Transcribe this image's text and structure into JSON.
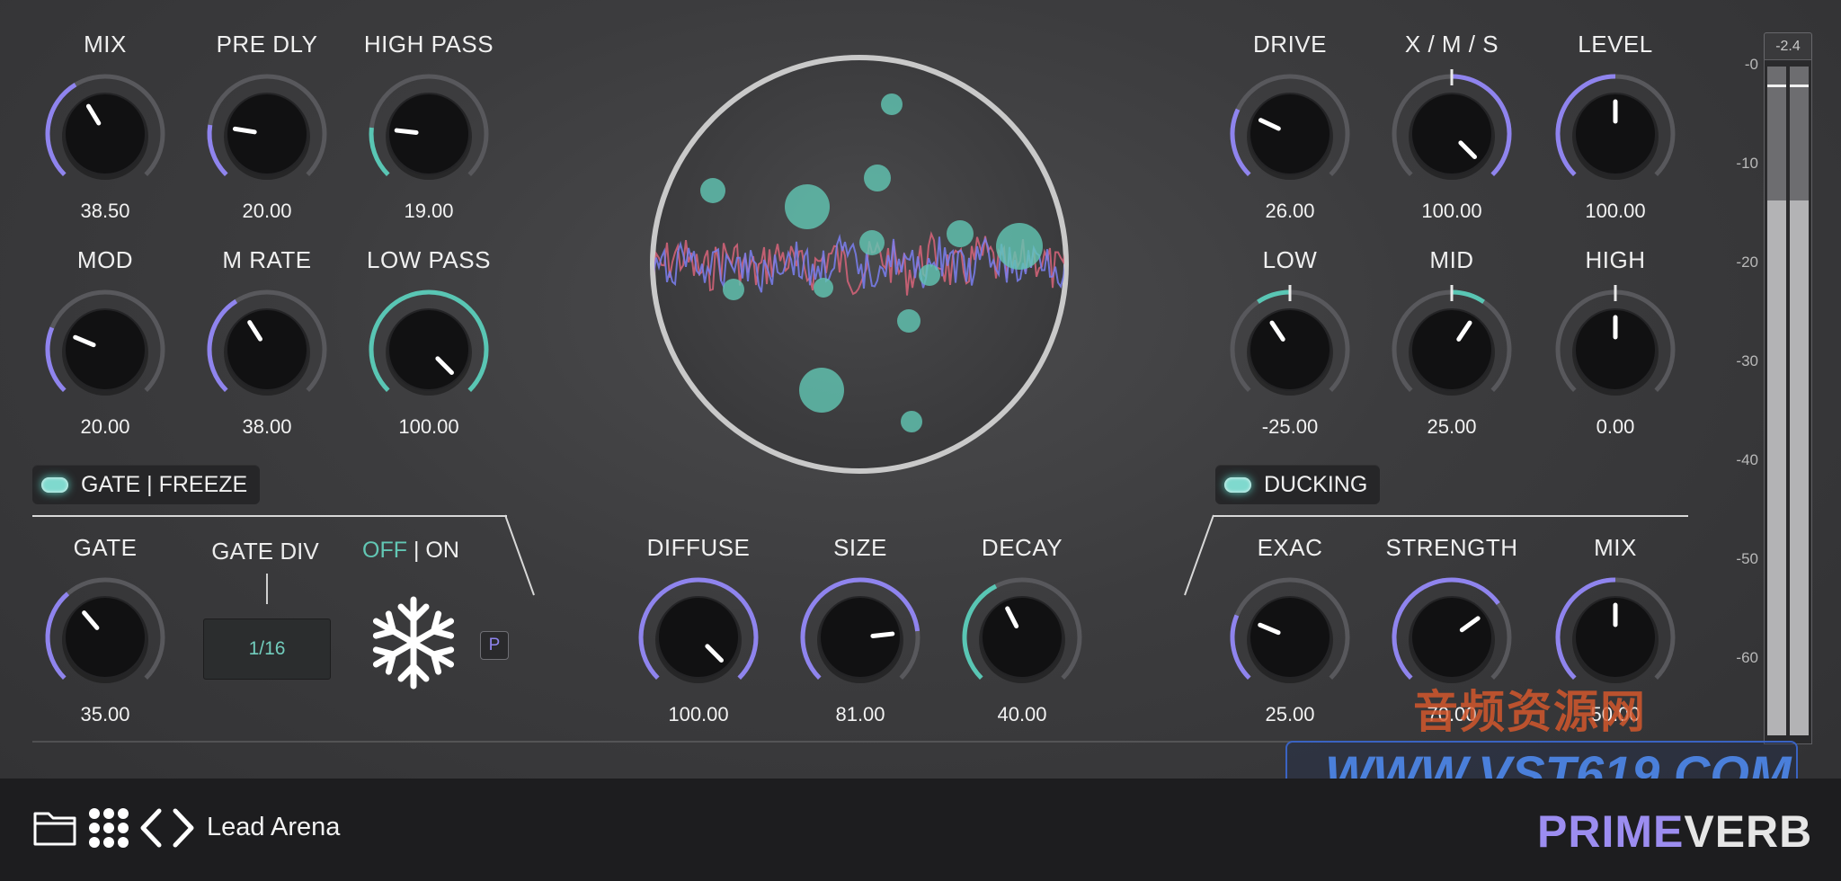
{
  "colors": {
    "accent_purple": "#8f84ee",
    "accent_teal": "#59c6b4",
    "track": "#58585c",
    "panel_bg": "#3b3b3d",
    "footer_bg": "#1d1d1f"
  },
  "knobs": [
    {
      "id": "mix",
      "label": "MIX",
      "value": "38.50",
      "fraction": 0.385,
      "arc": "purple"
    },
    {
      "id": "pre-dly",
      "label": "PRE DLY",
      "value": "20.00",
      "fraction": 0.2,
      "arc": "purple"
    },
    {
      "id": "high-pass",
      "label": "HIGH PASS",
      "value": "19.00",
      "fraction": 0.19,
      "arc": "teal"
    },
    {
      "id": "mod",
      "label": "MOD",
      "value": "20.00",
      "fraction": 0.25,
      "arc": "purple"
    },
    {
      "id": "m-rate",
      "label": "M RATE",
      "value": "38.00",
      "fraction": 0.38,
      "arc": "purple"
    },
    {
      "id": "low-pass",
      "label": "LOW PASS",
      "value": "100.00",
      "fraction": 1.0,
      "arc": "teal"
    },
    {
      "id": "drive",
      "label": "DRIVE",
      "value": "26.00",
      "fraction": 0.26,
      "arc": "purple"
    },
    {
      "id": "xms",
      "label": "X / M / S",
      "value": "100.00",
      "fraction": 1.0,
      "arc": "purple",
      "bipolar": true
    },
    {
      "id": "level",
      "label": "LEVEL",
      "value": "100.00",
      "fraction": 0.5,
      "arc": "purple"
    },
    {
      "id": "low",
      "label": "LOW",
      "value": "-25.00",
      "fraction": 0.375,
      "arc": "teal",
      "bipolar": true
    },
    {
      "id": "mid",
      "label": "MID",
      "value": "25.00",
      "fraction": 0.625,
      "arc": "teal",
      "bipolar": true
    },
    {
      "id": "high",
      "label": "HIGH",
      "value": "0.00",
      "fraction": 0.5,
      "arc": "teal",
      "bipolar": true
    },
    {
      "id": "gate",
      "label": "GATE",
      "value": "35.00",
      "fraction": 0.35,
      "arc": "purple"
    },
    {
      "id": "diffuse",
      "label": "DIFFUSE",
      "value": "100.00",
      "fraction": 1.0,
      "arc": "purple"
    },
    {
      "id": "size",
      "label": "SIZE",
      "value": "81.00",
      "fraction": 0.81,
      "arc": "purple"
    },
    {
      "id": "decay",
      "label": "DECAY",
      "value": "40.00",
      "fraction": 0.4,
      "arc": "teal"
    },
    {
      "id": "exac",
      "label": "EXAC",
      "value": "25.00",
      "fraction": 0.25,
      "arc": "purple"
    },
    {
      "id": "strength",
      "label": "STRENGTH",
      "value": "70.00",
      "fraction": 0.7,
      "arc": "purple"
    },
    {
      "id": "duck-mix",
      "label": "MIX",
      "value": "50.00",
      "fraction": 0.5,
      "arc": "purple"
    }
  ],
  "gate_freeze": {
    "label": "GATE | FREEZE",
    "active": true
  },
  "ducking": {
    "label": "DUCKING",
    "active": true
  },
  "gate_div": {
    "label": "GATE DIV",
    "value": "1/16"
  },
  "freeze_toggle": {
    "off": "OFF",
    "sep": " | ",
    "on": "ON",
    "state": "OFF"
  },
  "freeze_icon": "snowflake-icon",
  "p_button": "P",
  "preset": {
    "name": "Lead Arena"
  },
  "footer_icons": [
    "folder-icon",
    "grid-icon",
    "chevron-left-icon",
    "chevron-right-icon"
  ],
  "brand": {
    "prime": "PRIME",
    "verb": "VERB"
  },
  "watermark": {
    "cn": "音频资源网",
    "url": "WWW.VST619.COM"
  },
  "meter": {
    "peak_readout": "-2.4",
    "scale": [
      "-0",
      "-10",
      "-20",
      "-30",
      "-40",
      "-50",
      "-60"
    ],
    "left_level": 0.8,
    "right_level": 0.8
  }
}
